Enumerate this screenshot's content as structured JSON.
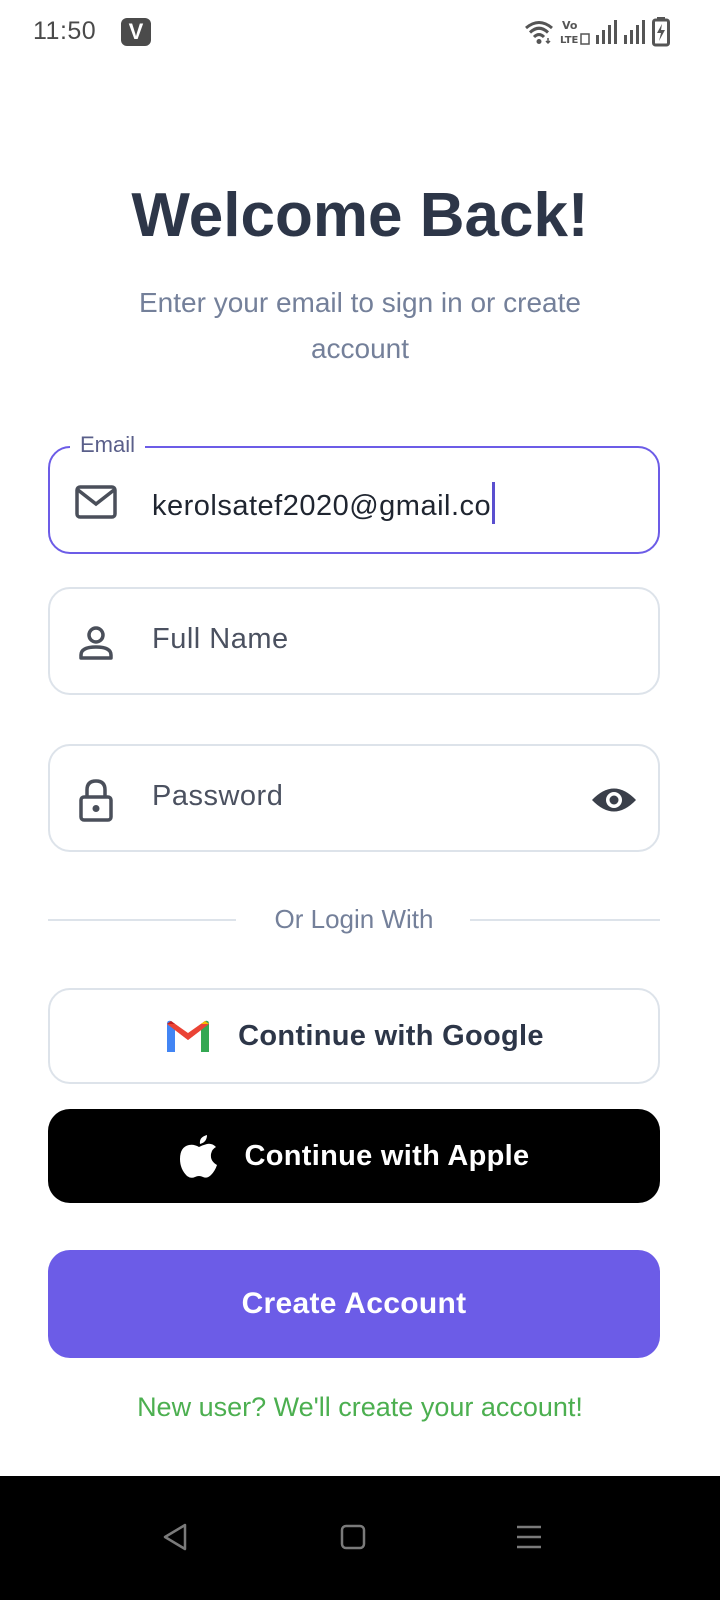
{
  "status_bar": {
    "time": "11:50",
    "app_badge": "V",
    "icons": [
      "wifi-icon",
      "volte-icon",
      "signal-icon",
      "signal-icon-2",
      "battery-charging-icon"
    ]
  },
  "header": {
    "title": "Welcome Back!",
    "subtitle": "Enter your email to sign in or create account"
  },
  "form": {
    "email": {
      "label": "Email",
      "value": "kerolsatef2020@gmail.co",
      "icon": "mail-icon"
    },
    "full_name": {
      "placeholder": "Full Name",
      "icon": "person-icon"
    },
    "password": {
      "placeholder": "Password",
      "icon": "lock-icon",
      "toggle_icon": "eye-icon"
    }
  },
  "divider": {
    "text": "Or Login With"
  },
  "social": {
    "google_label": "Continue with Google",
    "apple_label": "Continue with Apple"
  },
  "primary_action": {
    "label": "Create Account",
    "color": "#6c5ce7"
  },
  "footer": {
    "note": "New user? We'll create your account!",
    "color": "#4caf50"
  },
  "nav_bar": {
    "buttons": [
      "back-triangle-icon",
      "home-square-icon",
      "menu-lines-icon"
    ]
  }
}
